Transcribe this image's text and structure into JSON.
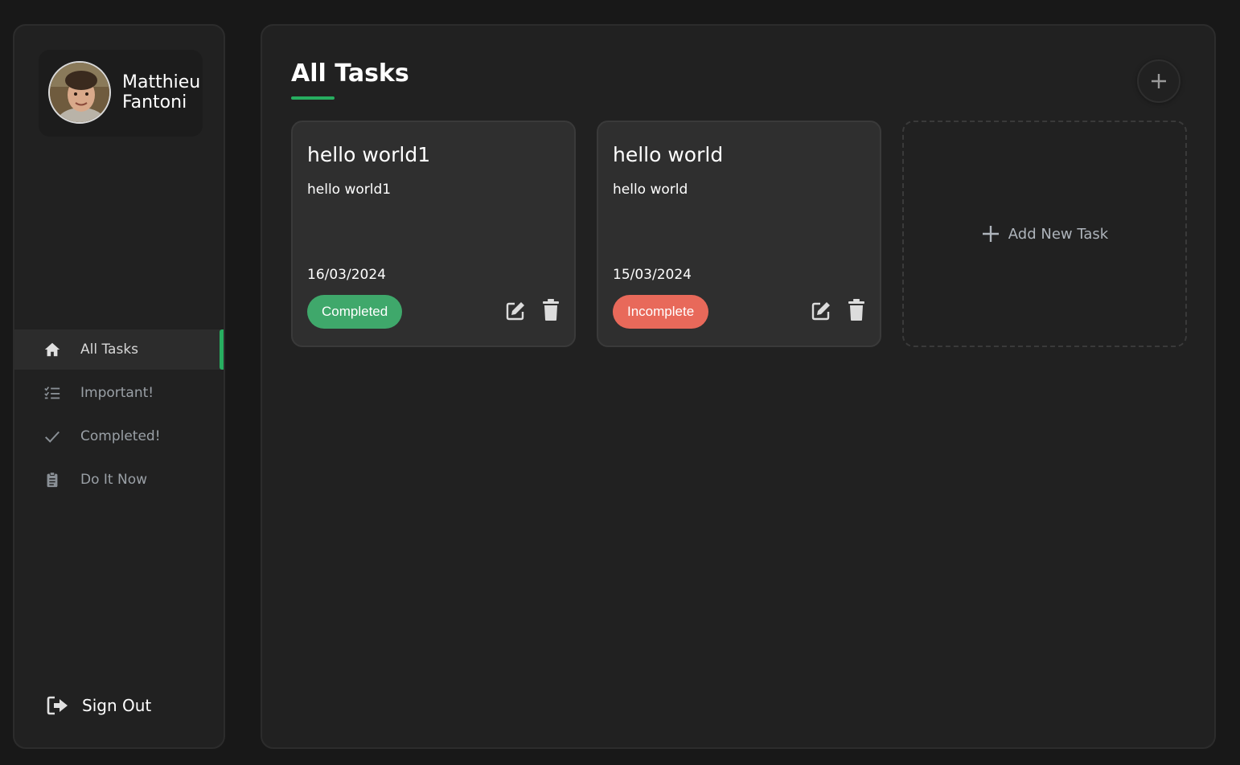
{
  "user": {
    "first_name": "Matthieu",
    "last_name": "Fantoni"
  },
  "sidebar": {
    "items": [
      {
        "label": "All Tasks",
        "icon": "home-icon",
        "active": true
      },
      {
        "label": "Important!",
        "icon": "list-check-icon",
        "active": false
      },
      {
        "label": "Completed!",
        "icon": "check-icon",
        "active": false
      },
      {
        "label": "Do It Now",
        "icon": "clipboard-icon",
        "active": false
      }
    ],
    "sign_out_label": "Sign Out"
  },
  "main": {
    "title": "All Tasks",
    "add_new_label": "Add New Task",
    "tasks": [
      {
        "title": "hello world1",
        "description": "hello world1",
        "date": "16/03/2024",
        "status": "Completed"
      },
      {
        "title": "hello world",
        "description": "hello world",
        "date": "15/03/2024",
        "status": "Incomplete"
      }
    ]
  },
  "colors": {
    "accent_green": "#27ae60",
    "completed": "#3fa86b",
    "incomplete": "#e8695a",
    "panel": "#212121",
    "card": "#2f2f2f"
  }
}
